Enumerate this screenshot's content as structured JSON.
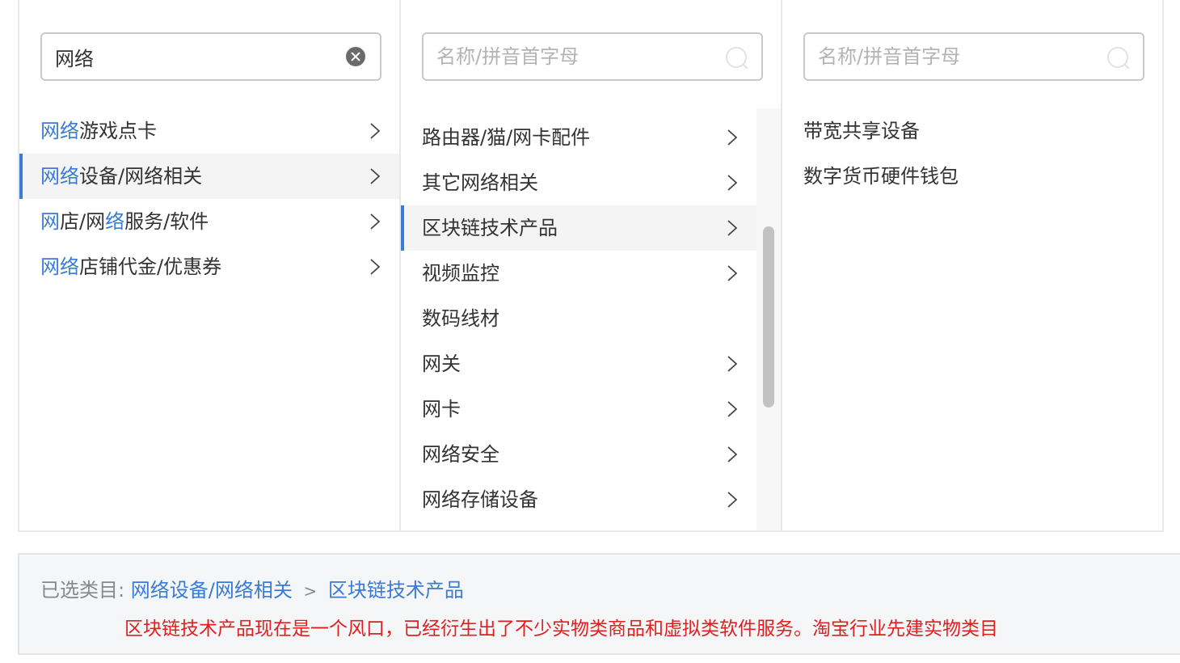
{
  "col1": {
    "search": {
      "value": "网络",
      "placeholder": ""
    },
    "items": [
      {
        "hl": "网络",
        "pre": "",
        "rest": "游戏点卡",
        "hl2": "",
        "rest2": "",
        "selected": false,
        "has_children": true
      },
      {
        "hl": "网络",
        "pre": "",
        "rest": "设备/网络相关",
        "hl2": "",
        "rest2": "",
        "selected": true,
        "has_children": true
      },
      {
        "hl": "网",
        "pre": "",
        "rest": "店/网",
        "hl2": "络",
        "rest2": "服务/软件",
        "selected": false,
        "has_children": true
      },
      {
        "hl": "网络",
        "pre": "",
        "rest": "店铺代金/优惠券",
        "hl2": "",
        "rest2": "",
        "selected": false,
        "has_children": true
      }
    ]
  },
  "col2": {
    "search": {
      "value": "",
      "placeholder": "名称/拼音首字母"
    },
    "items": [
      {
        "label": "路由器/猫/网卡配件",
        "selected": false,
        "has_children": true
      },
      {
        "label": "其它网络相关",
        "selected": false,
        "has_children": true
      },
      {
        "label": "区块链技术产品",
        "selected": true,
        "has_children": true
      },
      {
        "label": "视频监控",
        "selected": false,
        "has_children": true
      },
      {
        "label": "数码线材",
        "selected": false,
        "has_children": false
      },
      {
        "label": "网关",
        "selected": false,
        "has_children": true
      },
      {
        "label": "网卡",
        "selected": false,
        "has_children": true
      },
      {
        "label": "网络安全",
        "selected": false,
        "has_children": true
      },
      {
        "label": "网络存储设备",
        "selected": false,
        "has_children": true
      }
    ]
  },
  "col3": {
    "search": {
      "value": "",
      "placeholder": "名称/拼音首字母"
    },
    "items": [
      {
        "label": "带宽共享设备"
      },
      {
        "label": "数字货币硬件钱包"
      }
    ]
  },
  "footer": {
    "selected_label": "已选类目:",
    "crumbs": [
      "网络设备/网络相关",
      "区块链技术产品"
    ],
    "separator": ">",
    "notice": "区块链技术产品现在是一个风口，已经衍生出了不少实物类商品和虚拟类软件服务。淘宝行业先建实物类目"
  },
  "colors": {
    "accent": "#3a7bd5",
    "warning": "#e02020",
    "selected_bg": "#f4f4f4"
  },
  "icons": {
    "clear": "clear-circle-icon",
    "search": "search-icon",
    "chevron": "chevron-right-icon"
  }
}
